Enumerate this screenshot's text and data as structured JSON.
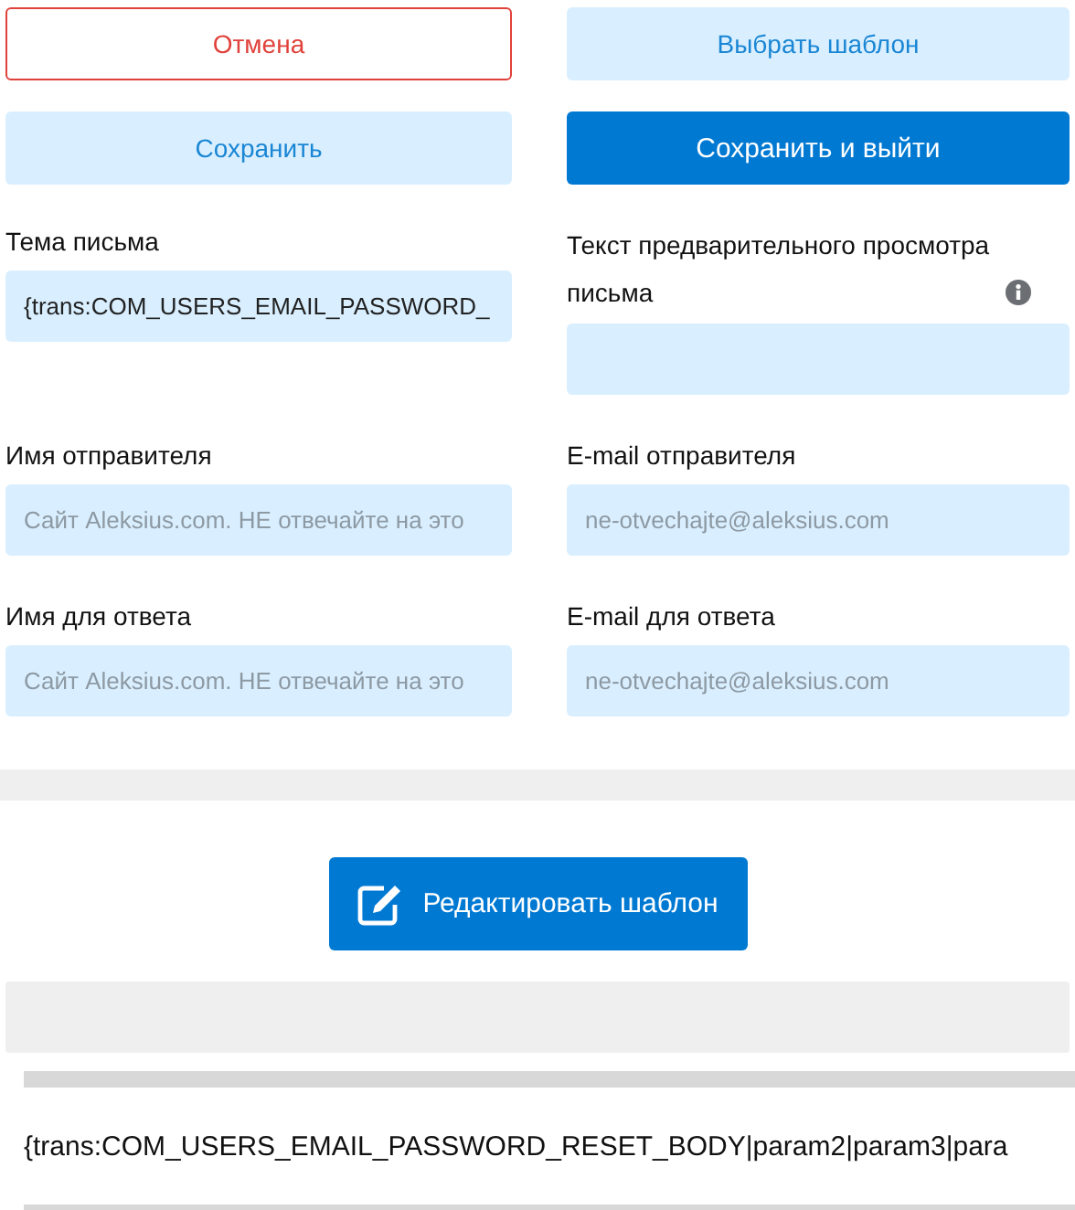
{
  "buttons": [
    {
      "label": "Отмена",
      "kind": "outline-danger"
    },
    {
      "label": "Выбрать шаблон",
      "kind": "light"
    },
    {
      "label": "Сохранить",
      "kind": "light"
    },
    {
      "label": "Сохранить и выйти",
      "kind": "primary"
    }
  ],
  "fields": [
    {
      "label": "Тема письма",
      "value": "{trans:COM_USERS_EMAIL_PASSWORD_"
    },
    {
      "label": "Текст предварительного просмотра письма",
      "info": true
    },
    {
      "label": "Имя отправителя",
      "placeholder": "Сайт Aleksius.com. НЕ отвечайте на это"
    },
    {
      "label": "E-mail отправителя",
      "placeholder": "ne-otvechajte@aleksius.com"
    },
    {
      "label": "Имя для ответа",
      "placeholder": "Сайт Aleksius.com. НЕ отвечайте на это"
    },
    {
      "label": "E-mail для ответа",
      "placeholder": "ne-otvechajte@aleksius.com"
    }
  ],
  "edit_button": {
    "label": "Редактировать шаблон"
  },
  "editor": {
    "body": "{trans:COM_USERS_EMAIL_PASSWORD_RESET_BODY|param2|param3|para"
  }
}
